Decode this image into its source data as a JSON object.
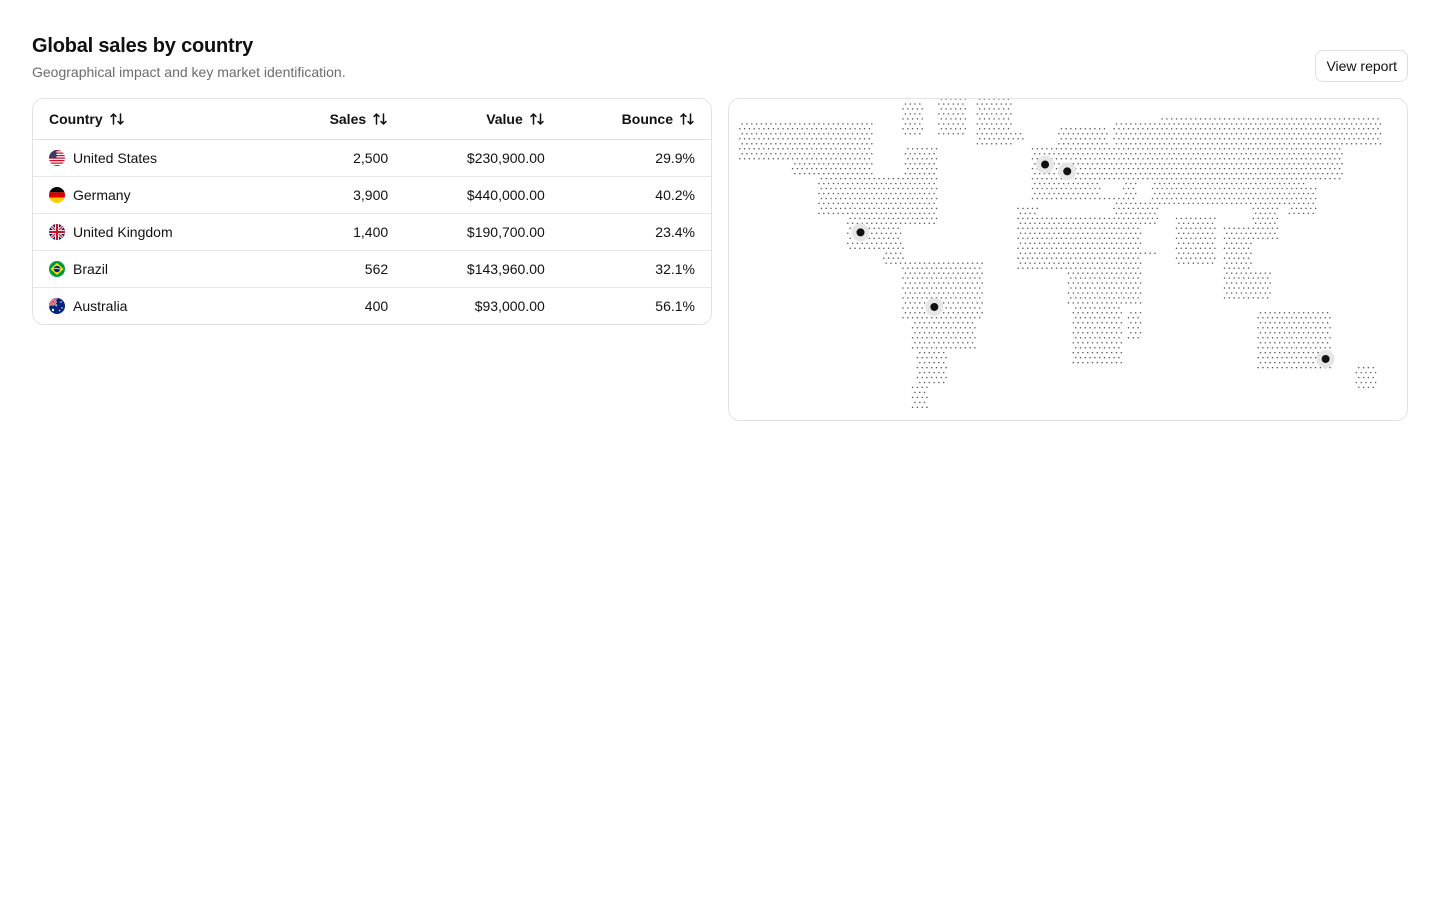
{
  "header": {
    "title": "Global sales by country",
    "subtitle": "Geographical impact and key market identification.",
    "view_report_label": "View report"
  },
  "table": {
    "columns": {
      "country": "Country",
      "sales": "Sales",
      "value": "Value",
      "bounce": "Bounce"
    },
    "sort_icon": "arrows-up-down-icon",
    "rows": [
      {
        "flag": "us-flag-icon",
        "country": "United States",
        "sales": "2,500",
        "value": "$230,900.00",
        "bounce": "29.9%"
      },
      {
        "flag": "de-flag-icon",
        "country": "Germany",
        "sales": "3,900",
        "value": "$440,000.00",
        "bounce": "40.2%"
      },
      {
        "flag": "gb-flag-icon",
        "country": "United Kingdom",
        "sales": "1,400",
        "value": "$190,700.00",
        "bounce": "23.4%"
      },
      {
        "flag": "br-flag-icon",
        "country": "Brazil",
        "sales": "562",
        "value": "$143,960.00",
        "bounce": "32.1%"
      },
      {
        "flag": "au-flag-icon",
        "country": "Australia",
        "sales": "400",
        "value": "$93,000.00",
        "bounce": "56.1%"
      }
    ]
  },
  "map": {
    "style": "dotted world map",
    "dot_color": "#555555",
    "marker_color": "#111111",
    "marker_halo_color": "#e6e6e6",
    "markers": [
      {
        "name": "United States",
        "lon": -102,
        "lat": 23
      },
      {
        "name": "United Kingdom",
        "lon": -2,
        "lat": 53
      },
      {
        "name": "Germany",
        "lon": 10,
        "lat": 50
      },
      {
        "name": "Brazil",
        "lon": -62,
        "lat": -10
      },
      {
        "name": "Australia",
        "lon": 150,
        "lat": -33
      }
    ]
  }
}
